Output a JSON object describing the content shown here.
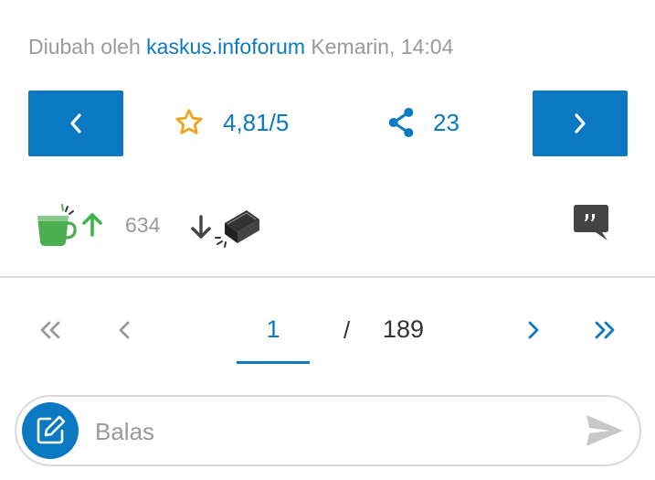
{
  "post": {
    "edited_prefix": "Diubah oleh",
    "edited_author": "kaskus.infoforum",
    "edited_time": "Kemarin, 14:04"
  },
  "nav": {
    "prev_icon": "chevron-left-icon",
    "next_icon": "chevron-right-icon",
    "rating_icon": "star-outline-icon",
    "rating": "4,81/5",
    "share_icon": "share-icon",
    "share_count": "23"
  },
  "reactions": {
    "cendol_icon": "cendol-cup-icon",
    "upvote_icon": "arrow-up-icon",
    "count": "634",
    "downvote_icon": "arrow-down-icon",
    "bata_icon": "bata-brick-icon",
    "quote_icon": "quote-bubble-icon"
  },
  "pagination": {
    "current_page": "1",
    "separator": "/",
    "total_pages": "189"
  },
  "reply": {
    "placeholder": "Balas",
    "edit_icon": "edit-note-icon",
    "send_icon": "send-icon"
  },
  "colors": {
    "accent": "#0b78c2",
    "upvote": "#3bb54a",
    "rating_star": "#f0a520",
    "muted": "#9a9a9a"
  }
}
